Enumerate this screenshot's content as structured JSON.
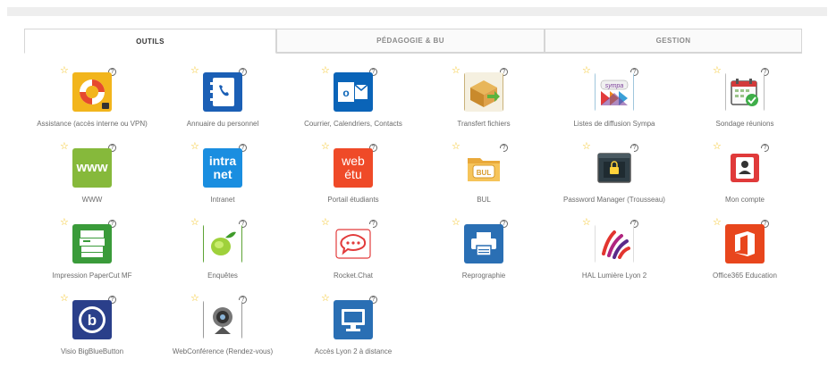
{
  "tabs": [
    {
      "label": "OUTILS",
      "active": true
    },
    {
      "label": "PÉDAGOGIE & BU",
      "active": false
    },
    {
      "label": "GESTION",
      "active": false
    }
  ],
  "help_glyph": "?",
  "star_glyph": "☆",
  "colors": {
    "star": "#f3c21b",
    "tab_border": "#d6d6d6",
    "label_text": "#6c6c6c"
  },
  "apps": [
    {
      "label": "Assistance (accès interne ou VPN)",
      "icon": "lifebuoy-icon"
    },
    {
      "label": "Annuaire du personnel",
      "icon": "phonebook-icon"
    },
    {
      "label": "Courrier, Calendriers, Contacts",
      "icon": "outlook-icon"
    },
    {
      "label": "Transfert fichiers",
      "icon": "file-transfer-icon"
    },
    {
      "label": "Listes de diffusion Sympa",
      "icon": "sympa-icon"
    },
    {
      "label": "Sondage réunions",
      "icon": "calendar-poll-icon"
    },
    {
      "label": "WWW",
      "icon": "www-icon",
      "icon_text": "www"
    },
    {
      "label": "Intranet",
      "icon": "intranet-icon",
      "icon_text": [
        "intra",
        "net"
      ]
    },
    {
      "label": "Portail étudiants",
      "icon": "web-etu-icon",
      "icon_text": [
        "web",
        "étu"
      ]
    },
    {
      "label": "BUL",
      "icon": "bul-folder-icon",
      "icon_text": "BUL"
    },
    {
      "label": "Password Manager (Trousseau)",
      "icon": "password-manager-icon"
    },
    {
      "label": "Mon compte",
      "icon": "account-icon"
    },
    {
      "label": "Impression PaperCut MF",
      "icon": "printer-copier-icon"
    },
    {
      "label": "Enquêtes",
      "icon": "lime-survey-icon"
    },
    {
      "label": "Rocket.Chat",
      "icon": "rocket-chat-icon"
    },
    {
      "label": "Reprographie",
      "icon": "printer-icon"
    },
    {
      "label": "HAL Lumière Lyon 2",
      "icon": "hal-icon"
    },
    {
      "label": "Office365 Education",
      "icon": "office365-icon"
    },
    {
      "label": "Visio BigBlueButton",
      "icon": "bigbluebutton-icon"
    },
    {
      "label": "WebConférence (Rendez-vous)",
      "icon": "webcam-icon"
    },
    {
      "label": "Accès Lyon 2 à distance",
      "icon": "remote-desktop-icon"
    }
  ]
}
